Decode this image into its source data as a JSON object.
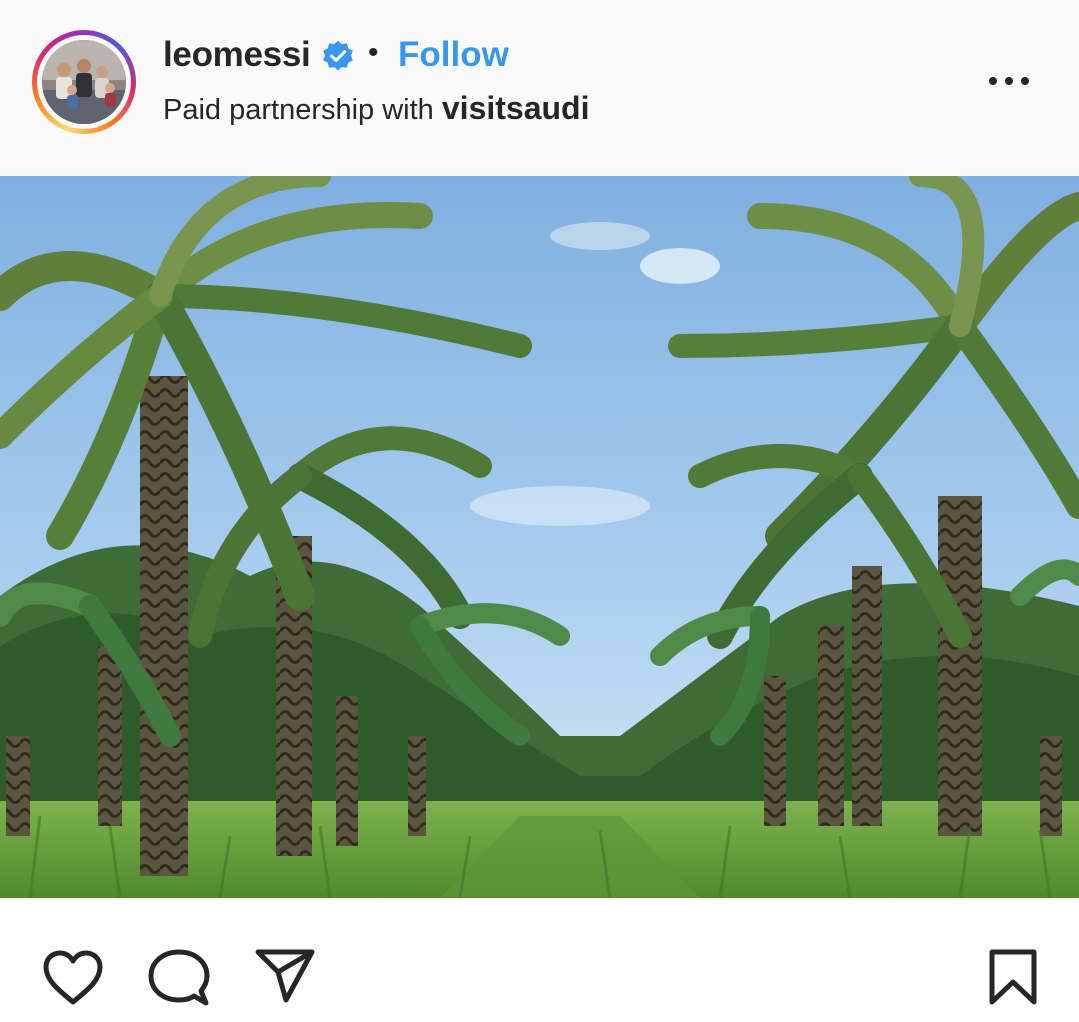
{
  "post": {
    "username": "leomessi",
    "separator": "•",
    "follow_label": "Follow",
    "partnership_prefix": "Paid partnership with ",
    "partner_name": "visitsaudi",
    "photo_description_icon": "palm-grove-photo"
  },
  "icons": {
    "verified": "verified-badge-icon",
    "more": "more-options-icon",
    "like": "heart-icon",
    "comment": "comment-icon",
    "share": "send-icon",
    "save": "bookmark-icon"
  },
  "colors": {
    "follow": "#3897f0",
    "verified": "#3897f0",
    "text": "#262626",
    "header_bg": "#fafafa"
  }
}
